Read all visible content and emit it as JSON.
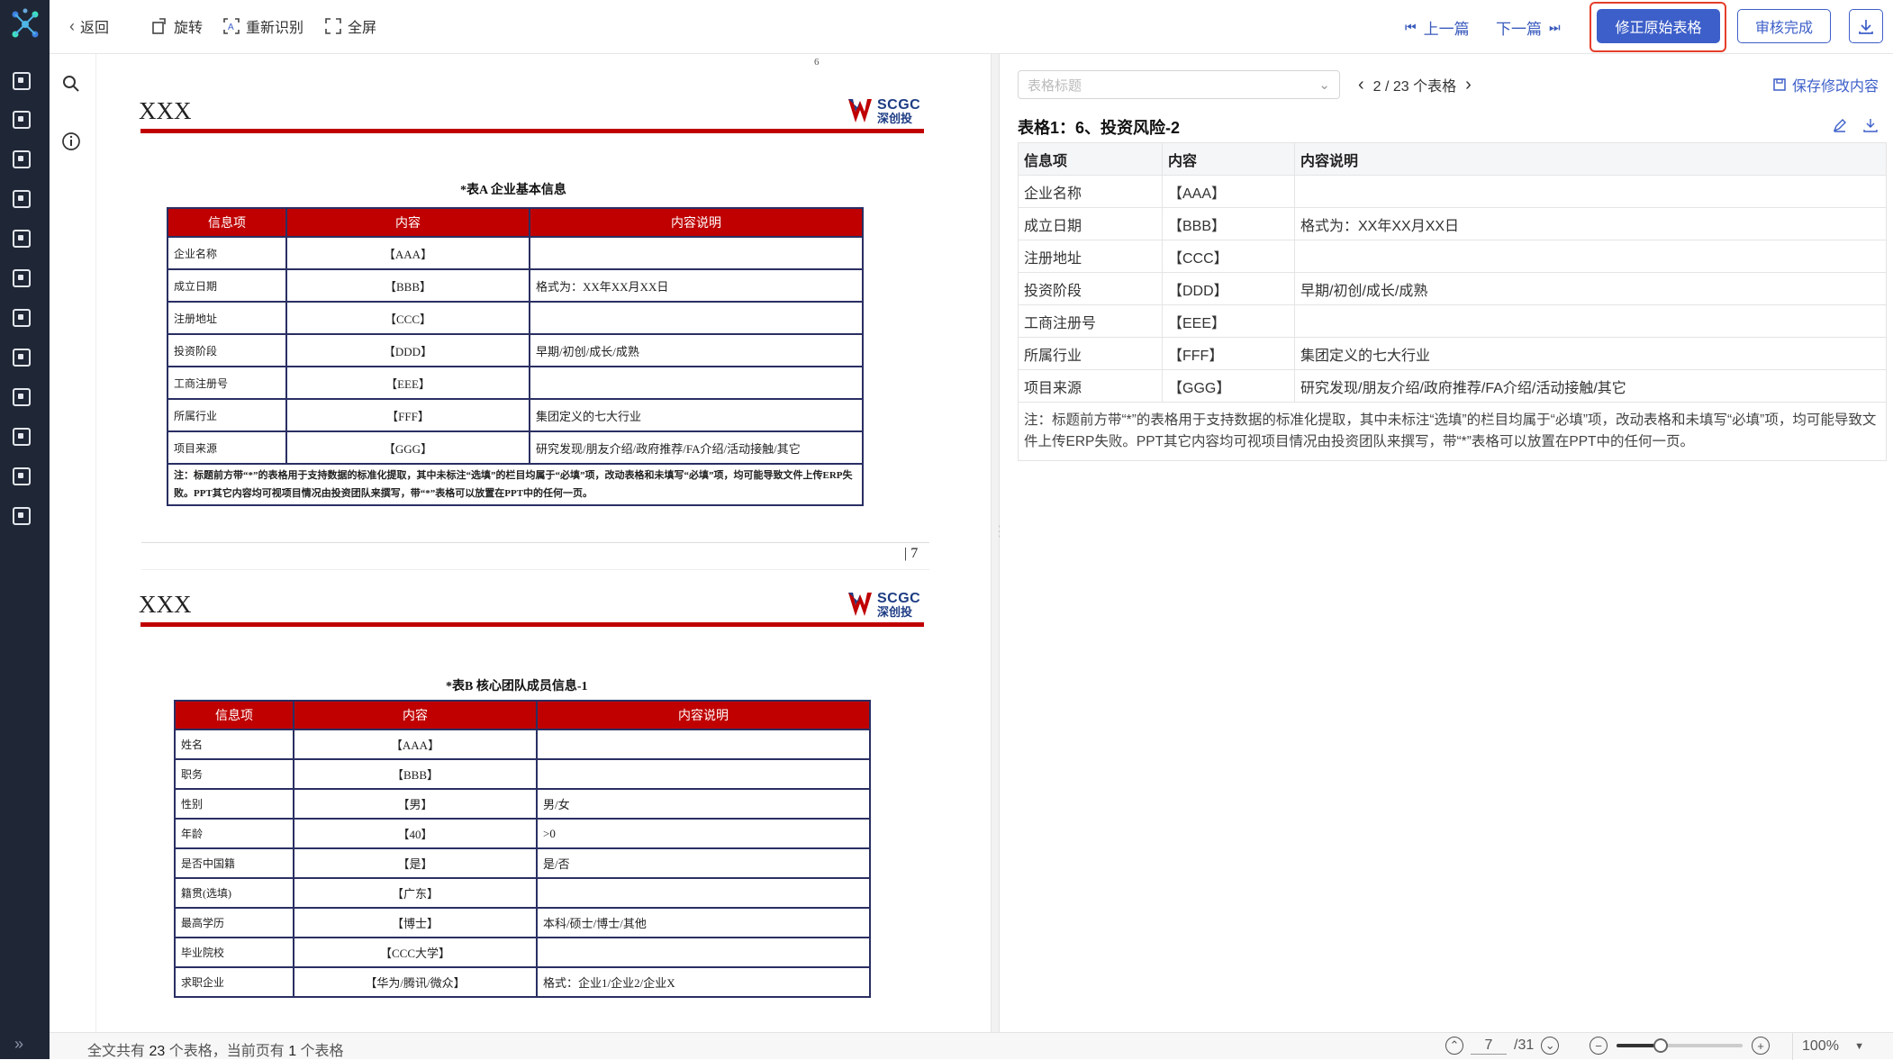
{
  "toolbar": {
    "back": "返回",
    "rotate": "旋转",
    "reocr": "重新识别",
    "fullscreen": "全屏",
    "prev_doc": "上一篇",
    "next_doc": "下一篇",
    "fix_table": "修正原始表格",
    "audit_done": "审核完成"
  },
  "doc": {
    "page_top_number": "6",
    "page_bottom_number": "| 7",
    "header_placeholder": "XXX",
    "logo_en": "SCGC",
    "logo_cn": "深创投",
    "tableA": {
      "caption": "*表A 企业基本信息",
      "headers": [
        "信息项",
        "内容",
        "内容说明"
      ],
      "rows": [
        [
          "企业名称",
          "【AAA】",
          ""
        ],
        [
          "成立日期",
          "【BBB】",
          "格式为：XX年XX月XX日"
        ],
        [
          "注册地址",
          "【CCC】",
          ""
        ],
        [
          "投资阶段",
          "【DDD】",
          "早期/初创/成长/成熟"
        ],
        [
          "工商注册号",
          "【EEE】",
          ""
        ],
        [
          "所属行业",
          "【FFF】",
          "集团定义的七大行业"
        ],
        [
          "项目来源",
          "【GGG】",
          "研究发现/朋友介绍/政府推荐/FA介绍/活动接触/其它"
        ]
      ],
      "note": "注：标题前方带“*”的表格用于支持数据的标准化提取，其中未标注“选填”的栏目均属于“必填”项，改动表格和未填写“必填”项，均可能导致文件上传ERP失败。PPT其它内容均可视项目情况由投资团队来撰写，带“*”表格可以放置在PPT中的任何一页。"
    },
    "tableB": {
      "caption": "*表B 核心团队成员信息-1",
      "headers": [
        "信息项",
        "内容",
        "内容说明"
      ],
      "rows": [
        [
          "姓名",
          "【AAA】",
          ""
        ],
        [
          "职务",
          "【BBB】",
          ""
        ],
        [
          "性别",
          "【男】",
          "男/女"
        ],
        [
          "年龄",
          "【40】",
          ">0"
        ],
        [
          "是否中国籍",
          "【是】",
          "是/否"
        ],
        [
          "籍贯(选填)",
          "【广东】",
          ""
        ],
        [
          "最高学历",
          "【博士】",
          "本科/硕士/博士/其他"
        ],
        [
          "毕业院校",
          "【CCC大学】",
          ""
        ],
        [
          "求职企业",
          "【华为/腾讯/微众】",
          "格式：企业1/企业2/企业X"
        ]
      ]
    }
  },
  "panel": {
    "select_placeholder": "表格标题",
    "pager_text": "2 / 23 个表格",
    "save": "保存修改内容",
    "title": "表格1：6、投资风险-2",
    "headers": [
      "信息项",
      "内容",
      "内容说明"
    ],
    "rows": [
      [
        "企业名称",
        "【AAA】",
        ""
      ],
      [
        "成立日期",
        "【BBB】",
        "格式为：XX年XX月XX日"
      ],
      [
        "注册地址",
        "【CCC】",
        ""
      ],
      [
        "投资阶段",
        "【DDD】",
        "早期/初创/成长/成熟"
      ],
      [
        "工商注册号",
        "【EEE】",
        ""
      ],
      [
        "所属行业",
        "【FFF】",
        "集团定义的七大行业"
      ],
      [
        "项目来源",
        "【GGG】",
        "研究发现/朋友介绍/政府推荐/FA介绍/活动接触/其它"
      ]
    ],
    "note": "注：标题前方带“*”的表格用于支持数据的标准化提取，其中未标注“选填”的栏目均属于“必填”项，改动表格和未填写“必填”项，均可能导致文件上传ERP失败。PPT其它内容均可视项目情况由投资团队来撰写，带“*”表格可以放置在PPT中的任何一页。"
  },
  "status": {
    "prefix": "全文共有",
    "total_tables": "23",
    "mid": "个表格，当前页有",
    "page_tables": "1",
    "suffix": "个表格",
    "current_page": "7",
    "total_pages": "/31",
    "zoom": "100%",
    "zoom_fraction": 0.35
  },
  "colors": {
    "accent": "#3d5fc9",
    "doc_red": "#c00000",
    "highlight_frame": "#e53e2a",
    "nav_bg": "#1f2736"
  }
}
